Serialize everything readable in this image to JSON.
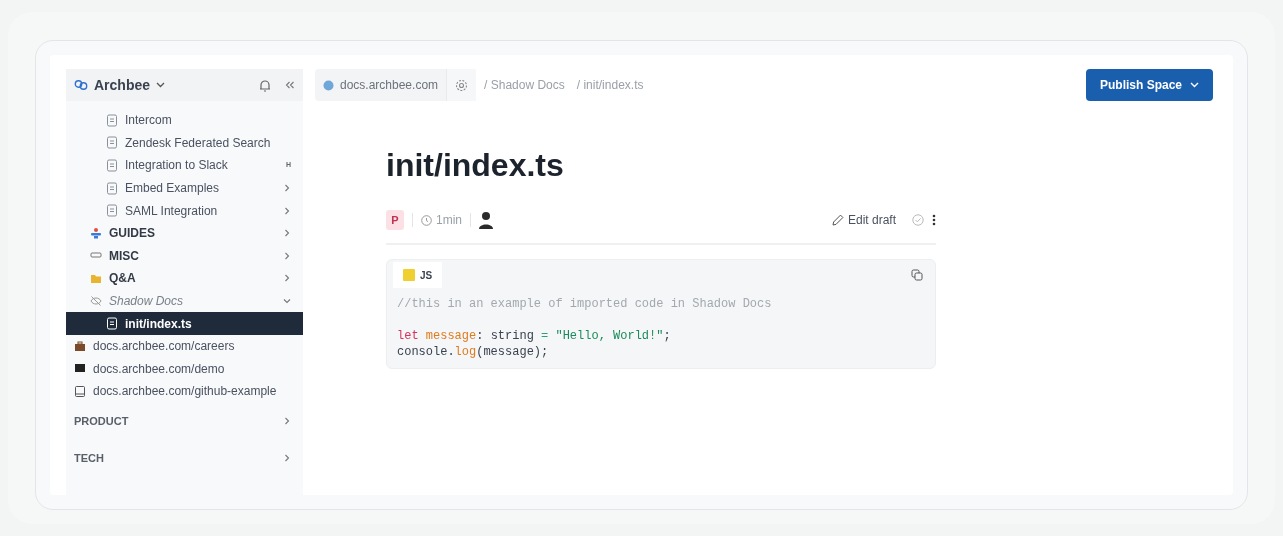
{
  "sidebar": {
    "title": "Archbee",
    "items": [
      {
        "kind": "page",
        "label": "Intercom"
      },
      {
        "kind": "page",
        "label": "Zendesk Federated Search"
      },
      {
        "kind": "page",
        "label": "Integration to Slack",
        "hint": "H"
      },
      {
        "kind": "page",
        "label": "Embed Examples",
        "expanded": false
      },
      {
        "kind": "page",
        "label": "SAML Integration",
        "expanded": false
      },
      {
        "kind": "section",
        "label": "GUIDES",
        "expanded": false
      },
      {
        "kind": "section",
        "label": "MISC",
        "expanded": false
      },
      {
        "kind": "section",
        "label": "Q&A",
        "expanded": false
      },
      {
        "kind": "shadow",
        "label": "Shadow Docs",
        "expanded": true,
        "children": [
          {
            "kind": "page",
            "label": "init/index.ts",
            "selected": true
          }
        ]
      },
      {
        "kind": "link",
        "label": "docs.archbee.com/careers"
      },
      {
        "kind": "link",
        "label": "docs.archbee.com/demo"
      },
      {
        "kind": "link",
        "label": "docs.archbee.com/github-example"
      },
      {
        "kind": "group",
        "label": "PRODUCT",
        "expanded": false
      },
      {
        "kind": "group",
        "label": "TECH",
        "expanded": false
      }
    ]
  },
  "topbar": {
    "domain": "docs.archbee.com",
    "breadcrumb": [
      "/ Shadow Docs",
      "/ init/index.ts"
    ],
    "publish": "Publish Space"
  },
  "document": {
    "title": "init/index.ts",
    "author_initial": "P",
    "read_time": "1min",
    "edit": "Edit draft",
    "code": {
      "language": "JS",
      "paragraphs": [
        [
          {
            "tokens": [
              {
                "kind": "comment",
                "text": "//this in an example of imported code in Shadow Docs"
              }
            ]
          }
        ],
        [
          {
            "tokens": [
              {
                "kind": "keyword",
                "text": "let "
              },
              {
                "kind": "variable",
                "text": "message"
              },
              {
                "kind": "plain",
                "text": ": string "
              },
              {
                "kind": "operator",
                "text": "= "
              },
              {
                "kind": "string",
                "text": "\"Hello, World!\""
              },
              {
                "kind": "plain",
                "text": ";"
              }
            ]
          },
          {
            "tokens": [
              {
                "kind": "plain",
                "text": "console."
              },
              {
                "kind": "variable",
                "text": "log"
              },
              {
                "kind": "plain",
                "text": "(message);"
              }
            ]
          }
        ]
      ]
    }
  }
}
